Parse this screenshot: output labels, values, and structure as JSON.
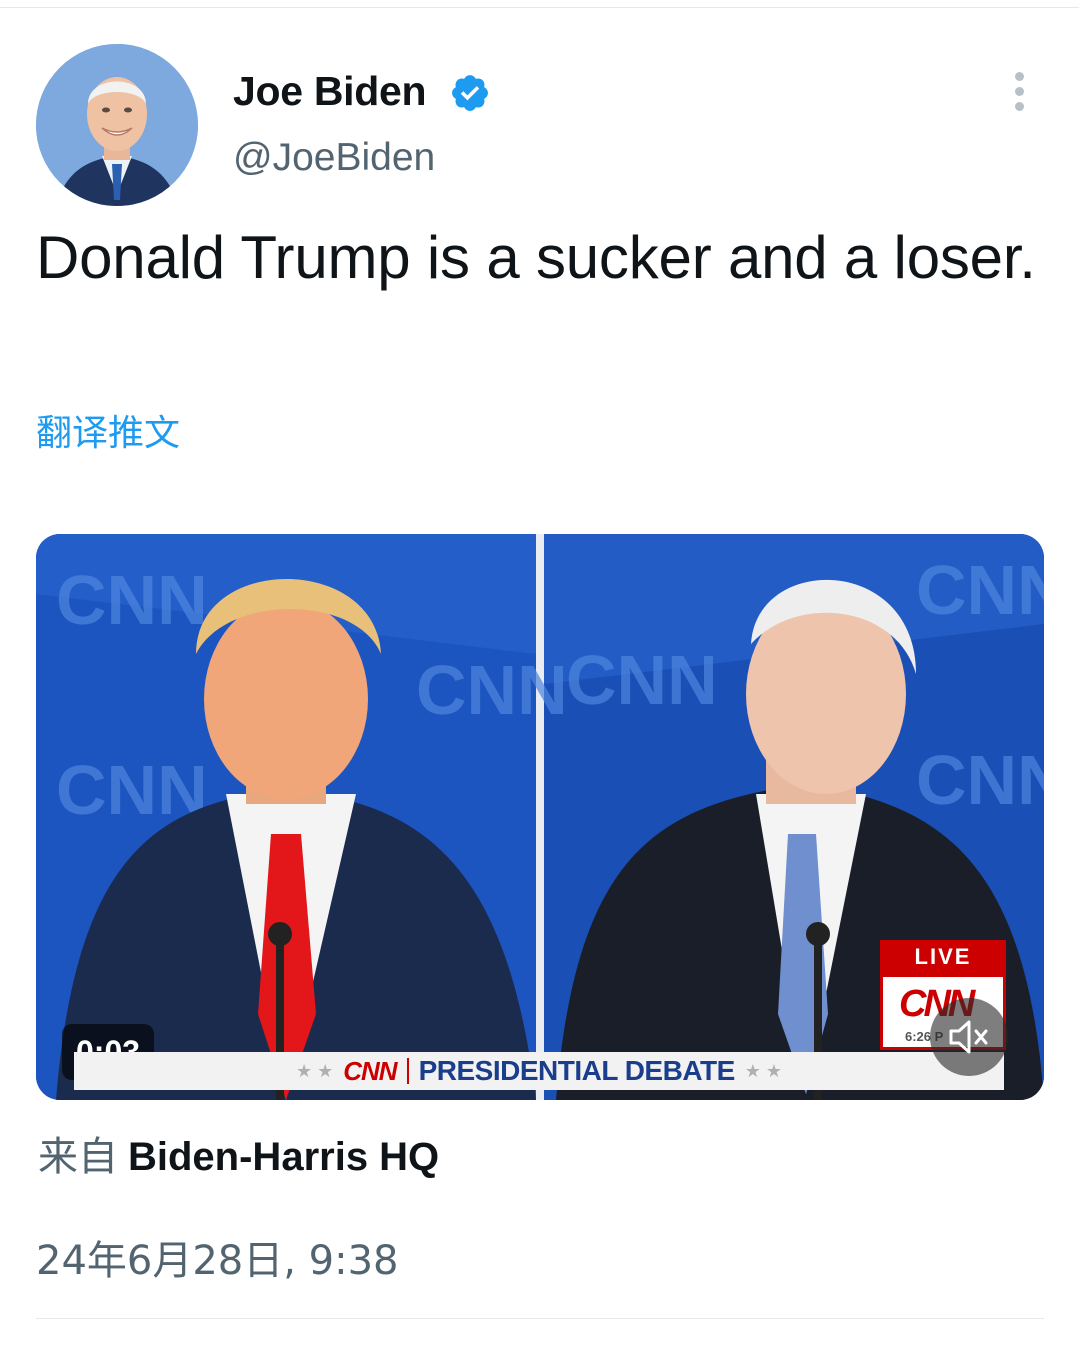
{
  "tweet": {
    "author": {
      "display_name": "Joe Biden",
      "handle": "@JoeBiden",
      "verified": true,
      "verified_icon": "verified-badge-icon",
      "avatar": "avatar-photo"
    },
    "text": "Donald Trump is a sucker and a loser.",
    "translate_label": "翻译推文",
    "media": {
      "type": "video",
      "duration": "0:03",
      "overlay": {
        "live_label": "LIVE",
        "network": "CNN",
        "live_time": "6:26 P",
        "lower_third_title": "PRESIDENTIAL DEBATE"
      },
      "mute_icon": "muted-speaker-icon"
    },
    "source_prefix": "来自",
    "source_name": "Biden-Harris HQ",
    "timestamp": "24年6月28日, 9:38"
  },
  "colors": {
    "accent": "#1d9bf0",
    "secondary_text": "#536471",
    "primary_text": "#0f1419",
    "cnn_red": "#cc0000",
    "debate_blue": "#1a3e8c"
  }
}
